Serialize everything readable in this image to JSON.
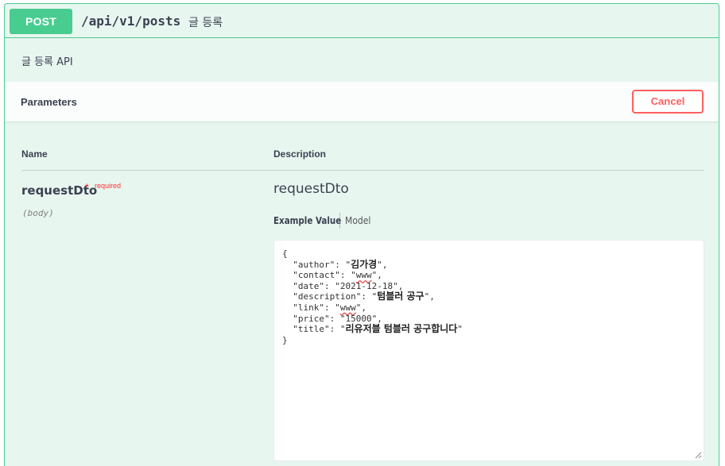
{
  "operation": {
    "method": "POST",
    "path": "/api/v1/posts",
    "summary": "글 등록",
    "description": "글 등록 API"
  },
  "parameters_section": {
    "title": "Parameters",
    "cancel_label": "Cancel"
  },
  "table": {
    "name_header": "Name",
    "description_header": "Description"
  },
  "parameter": {
    "name": "requestDto",
    "required_mark": "*",
    "required_label": "required",
    "in": "(body)",
    "type": "requestDto",
    "tabs": {
      "example_value": "Example Value",
      "model": "Model"
    },
    "example": {
      "author": "김가경",
      "contact": "www",
      "date": "2021-12-18",
      "description": "텀블러 공구",
      "link": "www",
      "price": "15000",
      "title": "리유저블 텀블러 공구합니다"
    }
  },
  "colors": {
    "post_green": "#49cc90",
    "post_bg": "#e8f6f0",
    "cancel_red": "#ff6060",
    "text": "#3b4151"
  }
}
